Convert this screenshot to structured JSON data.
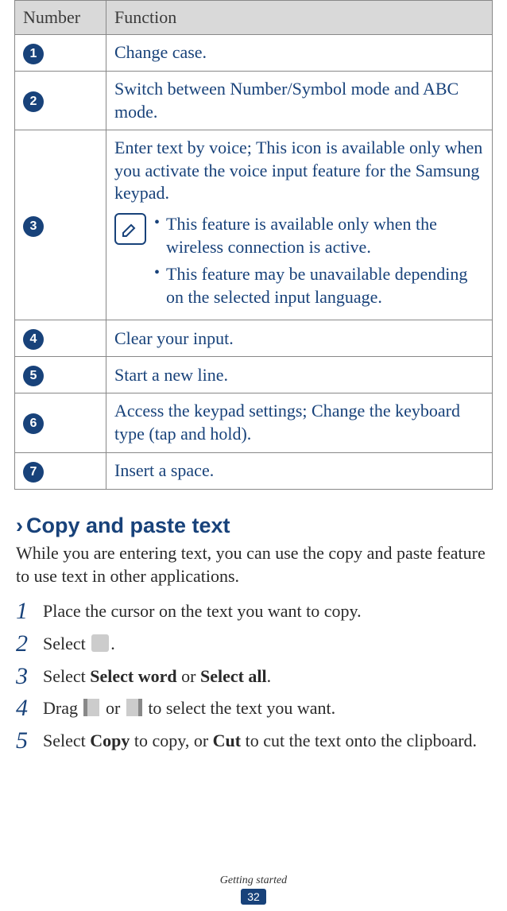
{
  "table": {
    "headers": {
      "number": "Number",
      "function": "Function"
    },
    "rows": [
      {
        "num": "1",
        "text": "Change case."
      },
      {
        "num": "2",
        "text": "Switch between Number/Symbol mode and ABC mode."
      },
      {
        "num": "3",
        "text": "Enter text by voice; This icon is available only when you activate the voice input feature for the Samsung keypad.",
        "notes": [
          "This feature is available only when the wireless connection is active.",
          "This feature may be unavailable depending on the selected input language."
        ]
      },
      {
        "num": "4",
        "text": "Clear your input."
      },
      {
        "num": "5",
        "text": "Start a new line."
      },
      {
        "num": "6",
        "text": "Access the keypad settings; Change the keyboard type (tap and hold)."
      },
      {
        "num": "7",
        "text": "Insert a space."
      }
    ]
  },
  "section": {
    "chevron": "›",
    "title": "Copy and paste text",
    "intro": "While you are entering text, you can use the copy and paste feature to use text in other applications."
  },
  "steps": {
    "s1": {
      "num": "1",
      "text": "Place the cursor on the text you want to copy."
    },
    "s2": {
      "num": "2",
      "pre": "Select ",
      "post": "."
    },
    "s3": {
      "num": "3",
      "pre": "Select ",
      "b1": "Select word",
      "mid": " or ",
      "b2": "Select all",
      "post": "."
    },
    "s4": {
      "num": "4",
      "pre": "Drag ",
      "mid": " or ",
      "post": " to select the text you want."
    },
    "s5": {
      "num": "5",
      "pre": "Select ",
      "b1": "Copy",
      "mid1": " to copy, or ",
      "b2": "Cut",
      "post": " to cut the text onto the clipboard."
    }
  },
  "footer": {
    "section": "Getting started",
    "page": "32"
  }
}
